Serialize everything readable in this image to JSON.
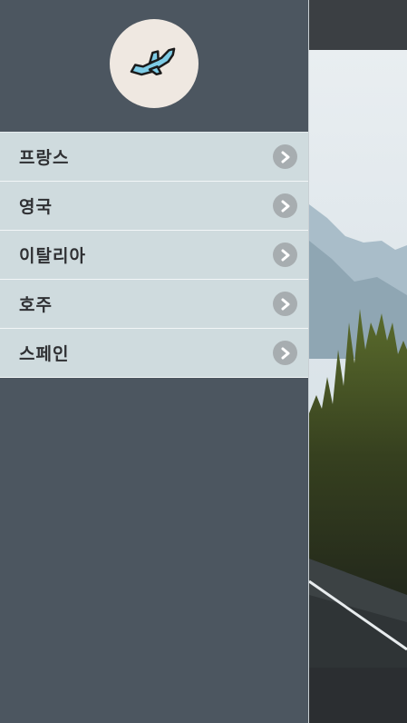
{
  "drawer": {
    "logo_icon": "airplane-departure-icon",
    "items": [
      {
        "label": "프랑스"
      },
      {
        "label": "영국"
      },
      {
        "label": "이탈리아"
      },
      {
        "label": "호주"
      },
      {
        "label": "스페인"
      }
    ]
  },
  "colors": {
    "drawer_bg": "#4c5660",
    "menu_item_bg": "#cfdbde",
    "logo_bg": "#efe8e1",
    "plane": "#7ecce6"
  }
}
